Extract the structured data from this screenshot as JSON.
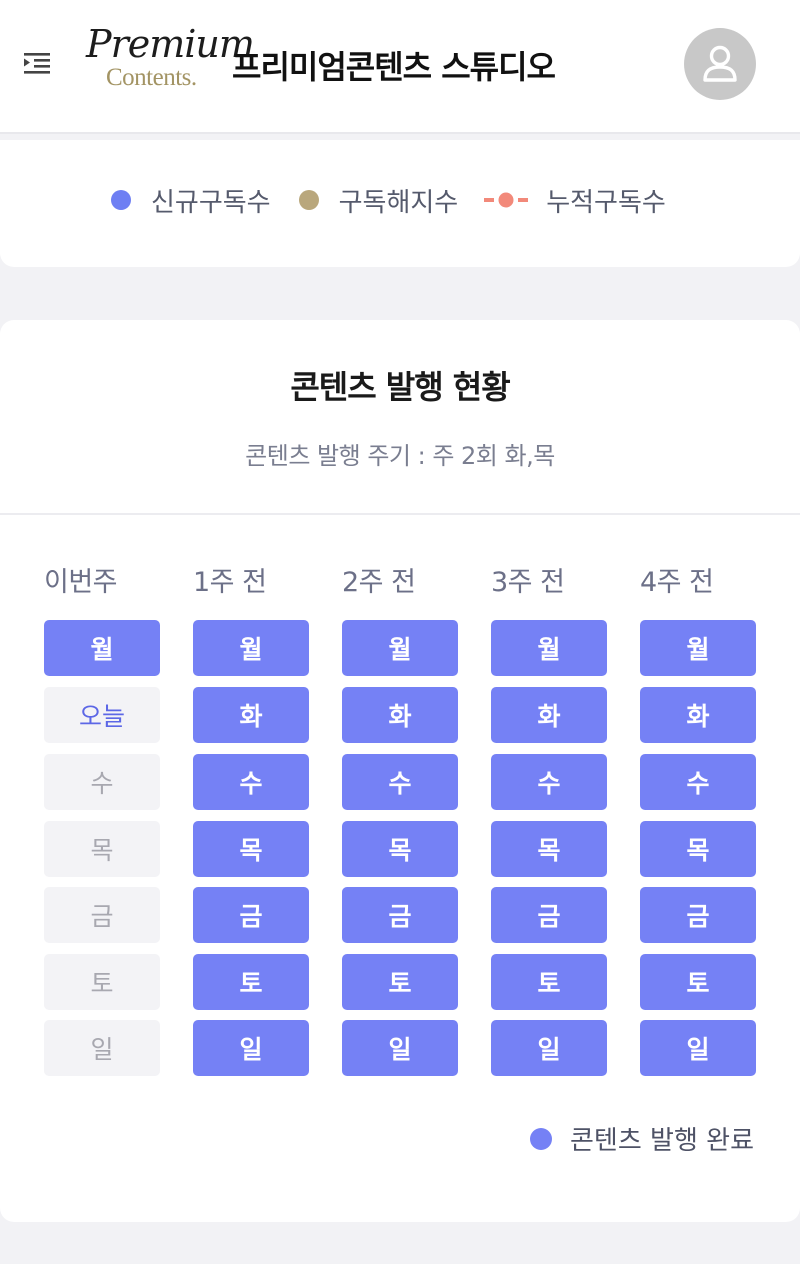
{
  "header": {
    "logo_line1": "Premium",
    "logo_line2": "Contents.",
    "title": "프리미엄콘텐츠 스튜디오",
    "menu_icon": "menu-icon",
    "avatar_icon": "user-icon"
  },
  "chart_legend": {
    "items": [
      {
        "label": "신규구독수",
        "color": "#6e7ff3",
        "marker": "dot"
      },
      {
        "label": "구독해지수",
        "color": "#b9a77c",
        "marker": "dot"
      },
      {
        "label": "누적구독수",
        "color": "#f2897a",
        "marker": "line-dot"
      }
    ]
  },
  "publish_status": {
    "title": "콘텐츠 발행 현황",
    "subtitle": "콘텐츠 발행 주기 : 주 2회 화,목",
    "columns": [
      {
        "label": "이번주",
        "days": [
          {
            "day": "월",
            "state": "done"
          },
          {
            "day": "오늘",
            "state": "today"
          },
          {
            "day": "수",
            "state": "pending"
          },
          {
            "day": "목",
            "state": "pending"
          },
          {
            "day": "금",
            "state": "pending"
          },
          {
            "day": "토",
            "state": "pending"
          },
          {
            "day": "일",
            "state": "pending"
          }
        ]
      },
      {
        "label": "1주 전",
        "days": [
          {
            "day": "월",
            "state": "done"
          },
          {
            "day": "화",
            "state": "done"
          },
          {
            "day": "수",
            "state": "done"
          },
          {
            "day": "목",
            "state": "done"
          },
          {
            "day": "금",
            "state": "done"
          },
          {
            "day": "토",
            "state": "done"
          },
          {
            "day": "일",
            "state": "done"
          }
        ]
      },
      {
        "label": "2주 전",
        "days": [
          {
            "day": "월",
            "state": "done"
          },
          {
            "day": "화",
            "state": "done"
          },
          {
            "day": "수",
            "state": "done"
          },
          {
            "day": "목",
            "state": "done"
          },
          {
            "day": "금",
            "state": "done"
          },
          {
            "day": "토",
            "state": "done"
          },
          {
            "day": "일",
            "state": "done"
          }
        ]
      },
      {
        "label": "3주 전",
        "days": [
          {
            "day": "월",
            "state": "done"
          },
          {
            "day": "화",
            "state": "done"
          },
          {
            "day": "수",
            "state": "done"
          },
          {
            "day": "목",
            "state": "done"
          },
          {
            "day": "금",
            "state": "done"
          },
          {
            "day": "토",
            "state": "done"
          },
          {
            "day": "일",
            "state": "done"
          }
        ]
      },
      {
        "label": "4주 전",
        "days": [
          {
            "day": "월",
            "state": "done"
          },
          {
            "day": "화",
            "state": "done"
          },
          {
            "day": "수",
            "state": "done"
          },
          {
            "day": "목",
            "state": "done"
          },
          {
            "day": "금",
            "state": "done"
          },
          {
            "day": "토",
            "state": "done"
          },
          {
            "day": "일",
            "state": "done"
          }
        ]
      }
    ],
    "legend_label": "콘텐츠 발행 완료",
    "done_color": "#7581f5"
  }
}
